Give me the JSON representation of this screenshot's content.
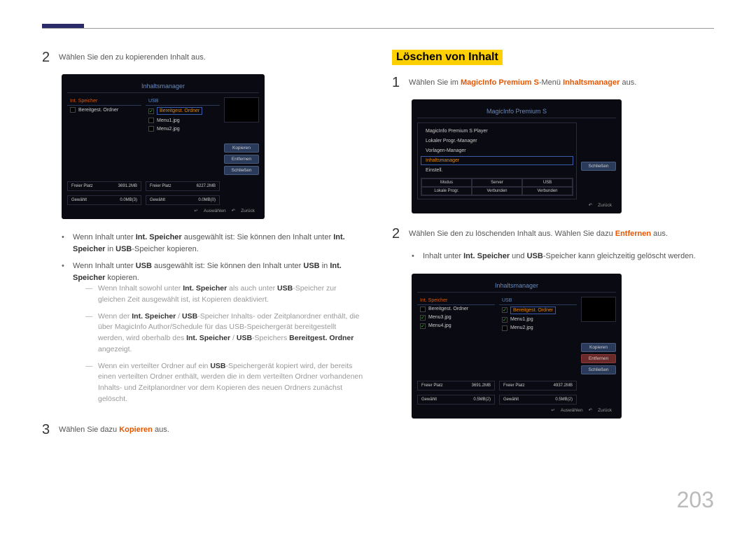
{
  "page_number": "203",
  "left": {
    "step2": {
      "num": "2",
      "text": "Wählen Sie den zu kopierenden Inhalt aus.",
      "screenshot": {
        "title": "Inhaltsmanager",
        "tab_left": "Int. Speicher",
        "tab_right": "USB",
        "item1": "Bereitgest. Ordner",
        "item1_hilite": "Bereitgest. Ordner",
        "item2": "Menu1.jpg",
        "item3": "Menu2.jpg",
        "btn_copy": "Kopieren",
        "btn_remove": "Entfernen",
        "btn_close": "Schließen",
        "free_label": "Freier Platz",
        "free_val1": "3691.2MB",
        "free_val2": "6227.2MB",
        "sel_label": "Gewählt",
        "sel_val1": "0.0MB(3)",
        "sel_val2": "0.0MB(0)",
        "footer_select": "Auswählen",
        "footer_back": "Zurück"
      },
      "bullets": [
        {
          "prefix": "Wenn Inhalt unter ",
          "b1": "Int. Speicher",
          "mid1": " ausgewählt ist: Sie können den Inhalt unter ",
          "b2": "Int. Speicher",
          "mid2": " in ",
          "b3": "USB",
          "suffix": "-Speicher kopieren."
        },
        {
          "prefix": "Wenn Inhalt unter ",
          "b1": "USB",
          "mid1": " ausgewählt ist: Sie können den Inhalt unter ",
          "b2": "USB",
          "mid2": " in ",
          "b3": "Int. Speicher",
          "suffix": " kopieren."
        }
      ],
      "dashes": [
        {
          "t1": "Wenn Inhalt sowohl unter ",
          "b1": "Int. Speicher",
          "t2": " als auch unter ",
          "b2": "USB",
          "t3": "-Speicher zur gleichen Zeit ausgewählt ist, ist Kopieren deaktiviert."
        },
        {
          "t1": "Wenn der ",
          "b1": "Int. Speicher",
          "t2": " / ",
          "b2": "USB",
          "t3": "-Speicher Inhalts- oder Zeitplanordner enthält, die über MagicInfo Author/Schedule für das USB-Speichergerät bereitgestellt werden, wird oberhalb des ",
          "b3": "Int. Speicher",
          "t4": " / ",
          "b4": "USB",
          "t5": "-Speichers ",
          "b5": "Bereitgest. Ordner",
          "t6": " angezeigt."
        },
        {
          "t1": "Wenn ein verteilter Ordner auf ein ",
          "b1": "USB",
          "t2": "-Speichergerät kopiert wird, der bereits einen verteilten Ordner enthält, werden die in dem verteilten Ordner vorhandenen Inhalts- und Zeitplanordner vor dem Kopieren des neuen Ordners zunächst gelöscht."
        }
      ]
    },
    "step3": {
      "num": "3",
      "prefix": "Wählen Sie dazu ",
      "action": "Kopieren",
      "suffix": " aus."
    }
  },
  "right": {
    "heading": "Löschen von Inhalt",
    "step1": {
      "num": "1",
      "prefix": "Wählen Sie im ",
      "b1": "MagicInfo Premium S",
      "mid": "-Menü ",
      "b2": "Inhaltsmanager",
      "suffix": " aus.",
      "screenshot": {
        "title": "MagicInfo Premium S",
        "item1": "MagicInfo Premium S Player",
        "item2": "Lokaler Progr.-Manager",
        "item3": "Vorlagen-Manager",
        "item4": "Inhaltsmanager",
        "item5": "Einstell.",
        "btn_close": "Schließen",
        "grid_h1": "Modus",
        "grid_h2": "Server",
        "grid_h3": "USB",
        "grid_r1": "Lokale Progr.",
        "grid_r2": "Verbunden",
        "grid_r3": "Verbunden",
        "footer_back": "Zurück"
      }
    },
    "step2": {
      "num": "2",
      "prefix": "Wählen Sie den zu löschenden Inhalt aus. Wählen Sie dazu ",
      "action": "Entfernen",
      "suffix": " aus.",
      "bullet": {
        "prefix": "Inhalt unter ",
        "b1": "Int. Speicher",
        "mid": " und ",
        "b2": "USB",
        "suffix": "-Speicher kann gleichzeitig gelöscht werden."
      },
      "screenshot": {
        "title": "Inhaltsmanager",
        "tab_left": "Int. Speicher",
        "tab_right": "USB",
        "l_item1": "Bereitgest. Ordner",
        "l_item2": "Menu3.jpg",
        "l_item3": "Menu4.jpg",
        "r_item1": "Bereitgest. Ordner",
        "r_item2": "Menu1.jpg",
        "r_item3": "Menu2.jpg",
        "btn_copy": "Kopieren",
        "btn_remove": "Entfernen",
        "btn_close": "Schließen",
        "free_label": "Freier Platz",
        "free_val1": "3691.2MB",
        "free_val2": "4937.2MB",
        "sel_label": "Gewählt",
        "sel_val1": "0.5MB(2)",
        "sel_val2": "0.5MB(2)",
        "footer_select": "Auswählen",
        "footer_back": "Zurück"
      }
    }
  }
}
